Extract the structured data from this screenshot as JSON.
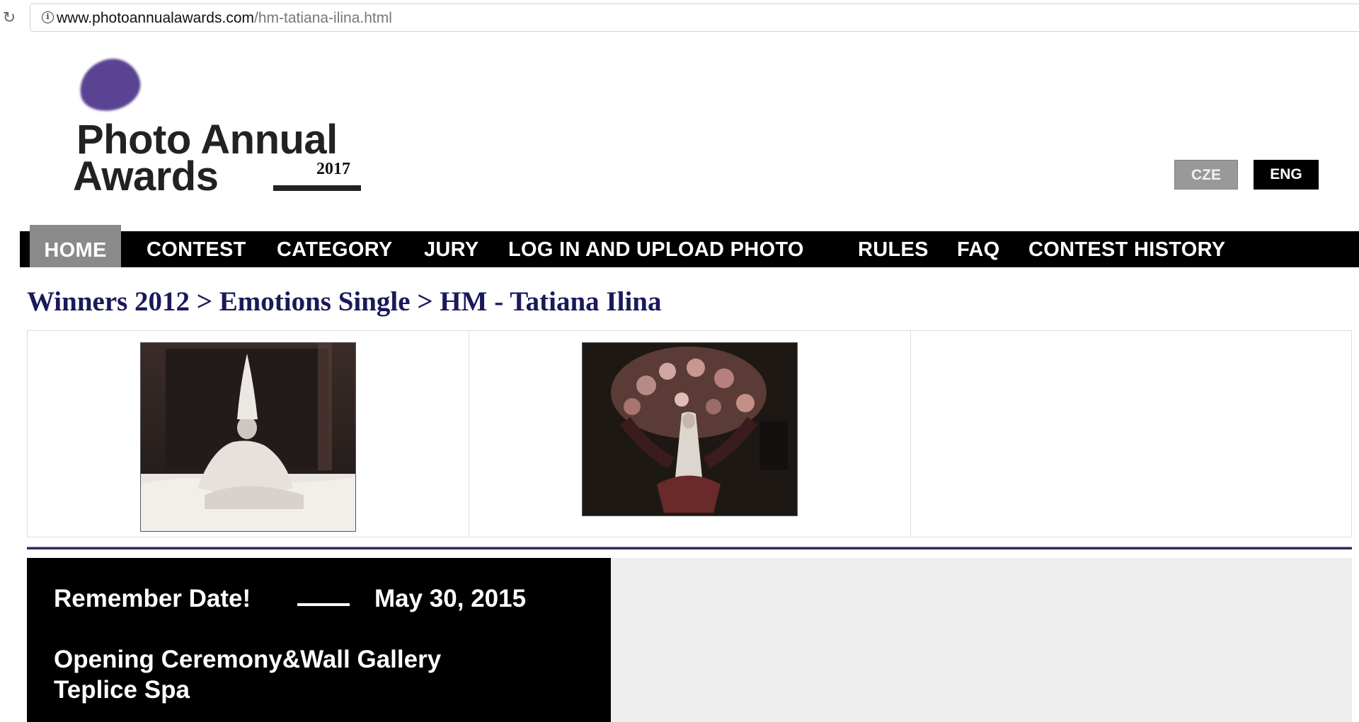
{
  "browser": {
    "url_host": "www.photoannualawards.com",
    "url_path": "/hm-tatiana-ilina.html"
  },
  "logo": {
    "line1": "Photo Annual",
    "line2": "Awards",
    "year": "2017"
  },
  "languages": [
    "CZE",
    "ENG"
  ],
  "nav": {
    "items": [
      "HOME",
      "CONTEST",
      "CATEGORY",
      "JURY",
      "LOG IN AND UPLOAD PHOTO",
      "RULES",
      "FAQ",
      "CONTEST HISTORY"
    ],
    "active": "HOME"
  },
  "breadcrumb": "Winners 2012 > Emotions Single > HM - Tatiana Ilina",
  "info": {
    "title": "Remember Date!",
    "date": "May 30, 2015",
    "event_line1": "Opening Ceremony&Wall Gallery",
    "event_line2": "Teplice Spa"
  },
  "colors": {
    "brand_purple": "#5a4392",
    "breadcrumb": "#1a1a5a",
    "nav_bg": "#000000",
    "nav_active": "#8a8a8a"
  }
}
